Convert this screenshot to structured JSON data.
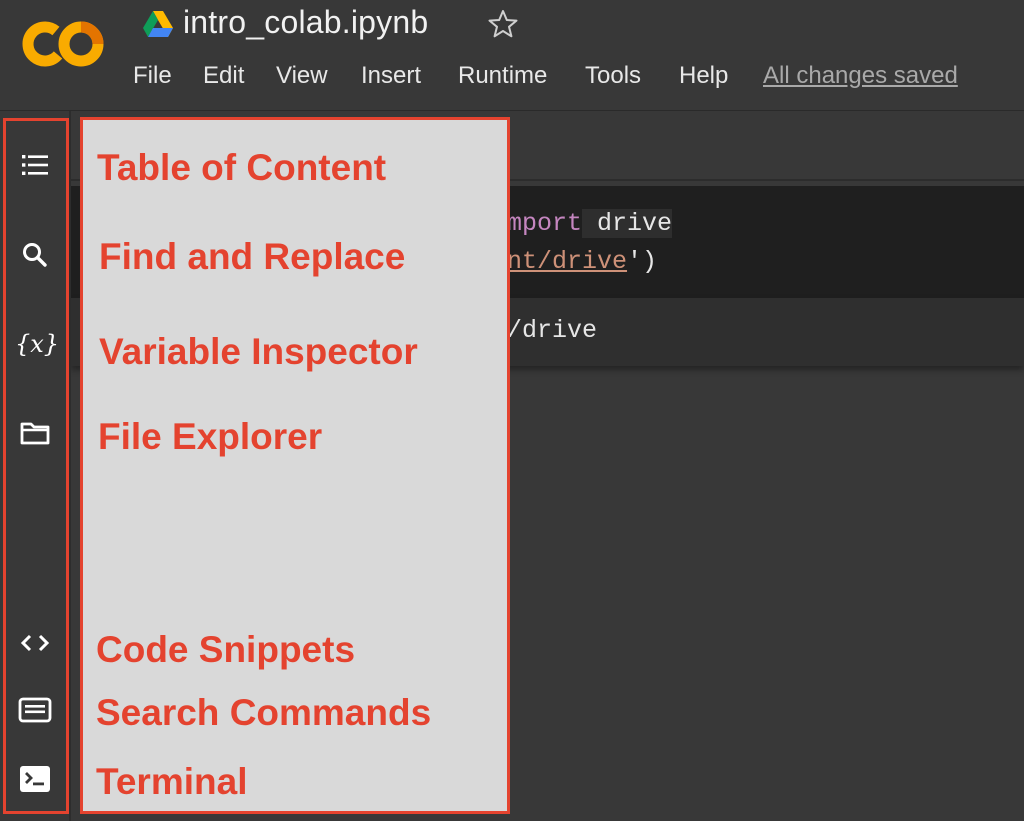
{
  "header": {
    "title": "intro_colab.ipynb",
    "logo_text": "CO",
    "star_icon": "star-outline-icon",
    "drive_icon": "google-drive-icon",
    "menu": [
      "File",
      "Edit",
      "View",
      "Insert",
      "Runtime",
      "Tools",
      "Help"
    ],
    "save_status": "All changes saved"
  },
  "sidebar": {
    "icons": [
      "table-of-contents-icon",
      "search-icon",
      "variables-icon",
      "folder-icon",
      "code-snippets-icon",
      "command-palette-icon",
      "terminal-icon"
    ],
    "variables_glyph": "{x}"
  },
  "code": {
    "line1_kw": "mport",
    "line1_rest": " drive",
    "line2_str": "nt/drive",
    "line2_rest": "')",
    "output": "/drive"
  },
  "annotations": {
    "labels": [
      "Table of Content",
      "Find and Replace",
      "Variable Inspector",
      "File Explorer",
      "Code Snippets",
      "Search Commands",
      "Terminal"
    ],
    "highlight_color": "#e4432f",
    "panel_color": "#d9d9d9"
  },
  "colors": {
    "background": "#383838",
    "logo_orange": "#f9ab00",
    "logo_dark_orange": "#e37400"
  }
}
